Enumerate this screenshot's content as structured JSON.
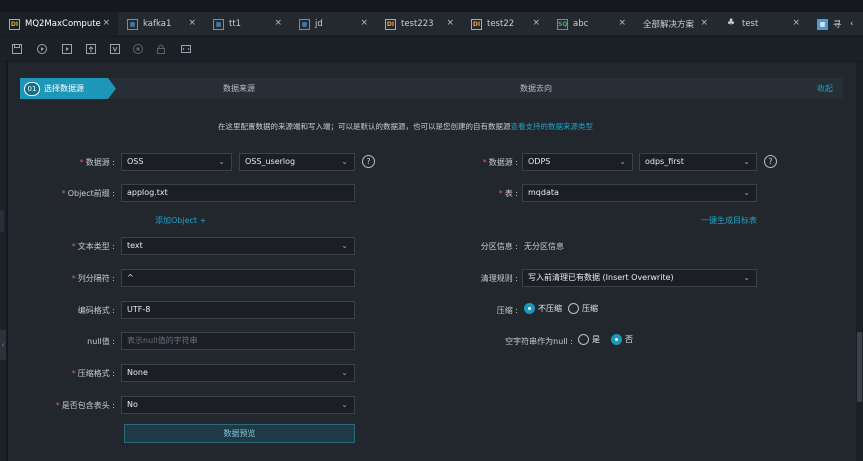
{
  "tabs": [
    {
      "label": "MQ2MaxCompute",
      "icon": "DI",
      "active": true
    },
    {
      "label": "kafka1",
      "icon": "grid"
    },
    {
      "label": "tt1",
      "icon": "grid"
    },
    {
      "label": "jd",
      "icon": "grid"
    },
    {
      "label": "test223",
      "icon": "DI"
    },
    {
      "label": "test22",
      "icon": "DI"
    },
    {
      "label": "abc",
      "icon": "SQ"
    },
    {
      "label": "全部解决方案",
      "icon": "none"
    },
    {
      "label": "test",
      "icon": "org"
    },
    {
      "label": "寻",
      "icon": "blue"
    }
  ],
  "tab_close": "×",
  "tab_more": "‹",
  "steps": {
    "num": "01",
    "step1": "选择数据源",
    "step2": "数据来源",
    "step3": "数据去向",
    "collapse": "收起"
  },
  "info": {
    "text": "在这里配置数据的来源端和写入端；可以是默认的数据源，也可以是您创建的自有数据源",
    "link": "查看支持的数据来源类型"
  },
  "source": {
    "datasource_label": "数据源 :",
    "datasource_type": "OSS",
    "datasource_name": "OSS_userlog",
    "object_label": "Object前缀 :",
    "object_value": "applog.txt",
    "add_object": "添加Object +",
    "text_type_label": "文本类型 :",
    "text_type_value": "text",
    "column_sep_label": "列分隔符 :",
    "column_sep_value": "^",
    "encoding_label": "编码格式 :",
    "encoding_value": "UTF-8",
    "null_label": "null值 :",
    "null_placeholder": "表示null值的字符串",
    "compress_label": "压缩格式 :",
    "compress_value": "None",
    "header_label": "是否包含表头 :",
    "header_value": "No",
    "preview_button": "数据预览"
  },
  "target": {
    "datasource_label": "数据源 :",
    "datasource_type": "ODPS",
    "datasource_name": "odps_first",
    "table_label": "表 :",
    "table_value": "mqdata",
    "create_table": "一键生成目标表",
    "partition_label": "分区信息 :",
    "partition_value": "无分区信息",
    "clear_rule_label": "清理规则 :",
    "clear_rule_value": "写入前清理已有数据 (Insert Overwrite)",
    "compression_label": "压缩 :",
    "compression_options": [
      "不压缩",
      "压缩"
    ],
    "compression_selected": "不压缩",
    "empty_null_label": "空字符串作为null :",
    "empty_null_options": [
      "是",
      "否"
    ],
    "empty_null_selected": "否"
  },
  "colors": {
    "accent": "#1d97b8",
    "link": "#1ea2c8",
    "required": "#e05b5b",
    "background": "#22272d"
  }
}
